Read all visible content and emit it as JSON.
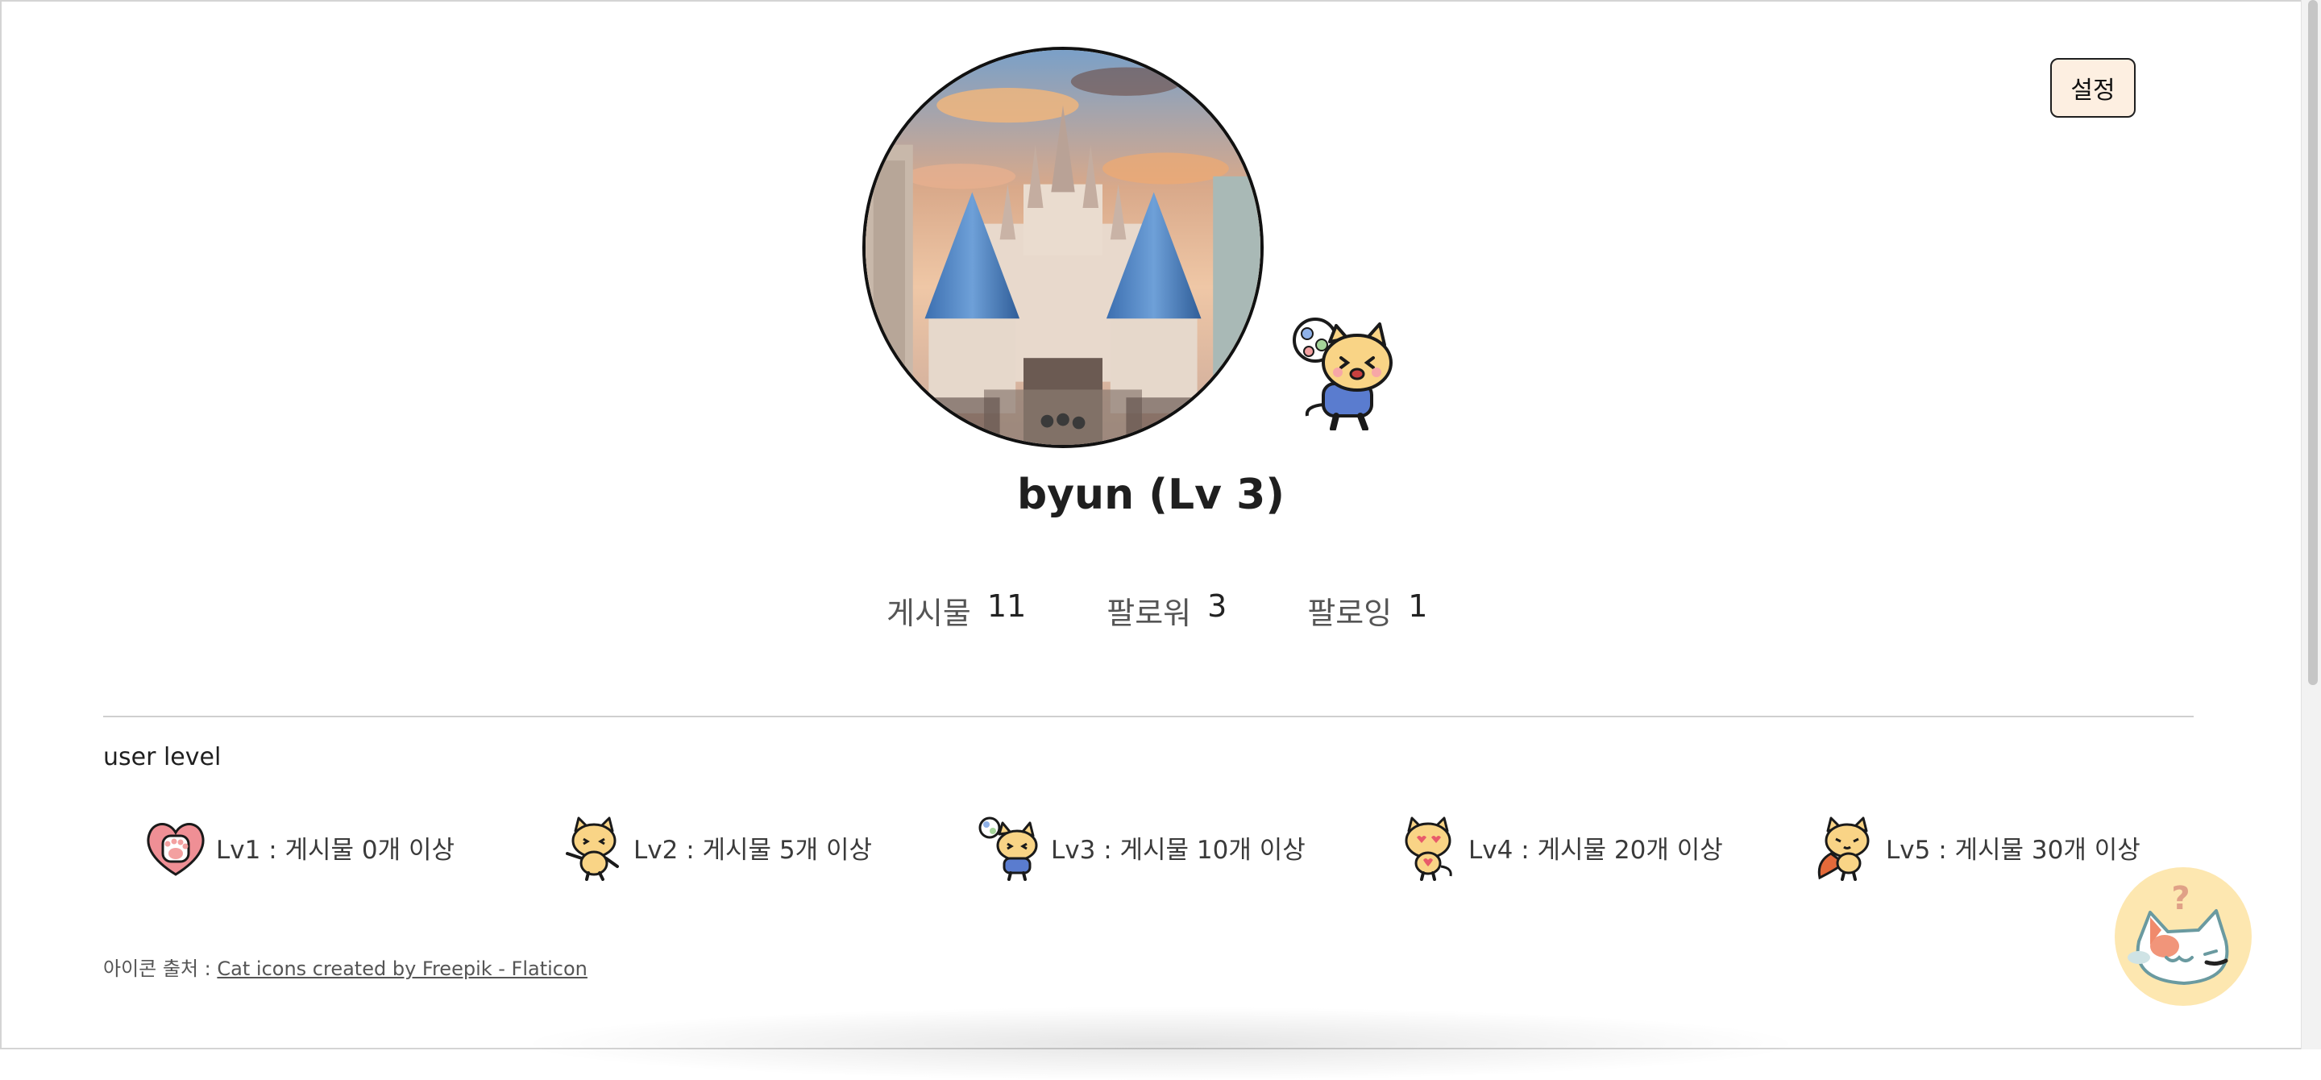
{
  "header": {
    "settings_label": "설정"
  },
  "profile": {
    "username_display": "byun (Lv 3)",
    "stats": [
      {
        "label": "게시물",
        "value": "11"
      },
      {
        "label": "팔로워",
        "value": "3"
      },
      {
        "label": "팔로잉",
        "value": "1"
      }
    ]
  },
  "levels_section": {
    "heading": "user level",
    "items": [
      {
        "text": "Lv1 : 게시물 0개 이상",
        "icon": "heart-paw-icon"
      },
      {
        "text": "Lv2 : 게시물 5개 이상",
        "icon": "cat-dancing-icon"
      },
      {
        "text": "Lv3 : 게시물 10개 이상",
        "icon": "cat-balloon-icon"
      },
      {
        "text": "Lv4 : 게시물 20개 이상",
        "icon": "cat-heart-eyes-icon"
      },
      {
        "text": "Lv5 : 게시물 30개 이상",
        "icon": "cat-hero-icon"
      }
    ]
  },
  "footer": {
    "credit_prefix": "아이콘 출처 :",
    "credit_link": "Cat icons created by Freepik - Flaticon"
  },
  "colors": {
    "settings_bg": "#fdefe1",
    "cat_body": "#f9d486",
    "help_bubble": "#fde7b0"
  }
}
